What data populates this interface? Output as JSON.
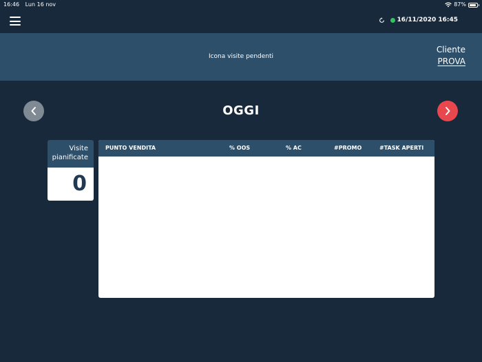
{
  "status_bar": {
    "time": "16:46",
    "date": "Lun 16 nov",
    "battery": "87%",
    "battery_level": 0.87
  },
  "nav": {
    "datetime": "16/11/2020 16:45",
    "sync_icon": "sync-icon",
    "online_color": "#33c45e"
  },
  "banner": {
    "pending_text": "Icona visite pendenti",
    "client_label": "Cliente",
    "client_name": "PROVA"
  },
  "day": {
    "title": "OGGI"
  },
  "visits": {
    "label_line1": "Visite",
    "label_line2": "pianificate",
    "count": "0"
  },
  "table": {
    "columns": [
      "PUNTO VENDITA",
      "% OOS",
      "% AC",
      "#PROMO",
      "#TASK APERTI"
    ],
    "rows": []
  },
  "colors": {
    "background": "#17293a",
    "panel": "#2d4f69",
    "prev_button": "#7f8a94",
    "next_button": "#e9474e"
  }
}
